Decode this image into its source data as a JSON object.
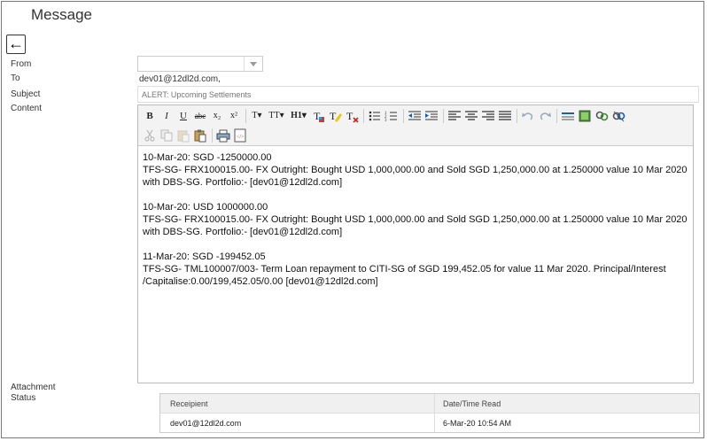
{
  "page": {
    "title": "Message"
  },
  "labels": {
    "from": "From",
    "to": "To",
    "subject": "Subject",
    "content": "Content",
    "attachment": "Attachment",
    "status": "Status"
  },
  "form": {
    "from_value": "",
    "to_value": "dev01@12dl2d.com,",
    "subject_placeholder": "ALERT: Upcoming Settlements"
  },
  "toolbar": {
    "row1": [
      "bold",
      "italic",
      "underline",
      "strikethrough",
      "subscript",
      "superscript",
      "font-size",
      "text-size",
      "heading",
      "text-color",
      "background-color",
      "remove-format",
      "bulleted-list",
      "numbered-list",
      "decrease-indent",
      "increase-indent",
      "align-left",
      "align-center",
      "align-right",
      "justify",
      "undo",
      "redo",
      "horizontal-rule",
      "insert-image",
      "insert-link",
      "remove-link"
    ],
    "row2": [
      "cut",
      "copy",
      "paste",
      "paste-text",
      "print",
      "source"
    ],
    "glyphs": {
      "bold": "B",
      "italic": "I",
      "underline": "U",
      "strikethrough": "abc",
      "subscript": "x₂",
      "superscript": "x²",
      "font-size": "T▾",
      "text-size": "TT▾",
      "heading": "H1▾"
    }
  },
  "content": {
    "blocks": [
      {
        "line1": "10-Mar-20: SGD -1250000.00",
        "line2": "TFS-SG- FRX100015.00- FX Outright: Bought USD 1,000,000.00 and Sold SGD 1,250,000.00 at 1.250000 value 10 Mar 2020 with DBS-SG. Portfolio:- [dev01@12dl2d.com]"
      },
      {
        "line1": "10-Mar-20: USD 1000000.00",
        "line2": "TFS-SG- FRX100015.00- FX Outright: Bought USD 1,000,000.00 and Sold SGD 1,250,000.00 at 1.250000 value 10 Mar 2020 with DBS-SG. Portfolio:- [dev01@12dl2d.com]"
      },
      {
        "line1": "11-Mar-20: SGD -199452.05",
        "line2": "TFS-SG- TML100007/003- Term Loan repayment to CITI-SG of SGD 199,452.05 for value 11 Mar 2020. Principal/Interest /Capitalise:0.00/199,452.05/0.00 [dev01@12dl2d.com]"
      }
    ]
  },
  "status_table": {
    "headers": [
      "Receipient",
      "Date/Time Read"
    ],
    "rows": [
      [
        "dev01@12dl2d.com",
        "6-Mar-20 10:54 AM"
      ]
    ]
  }
}
